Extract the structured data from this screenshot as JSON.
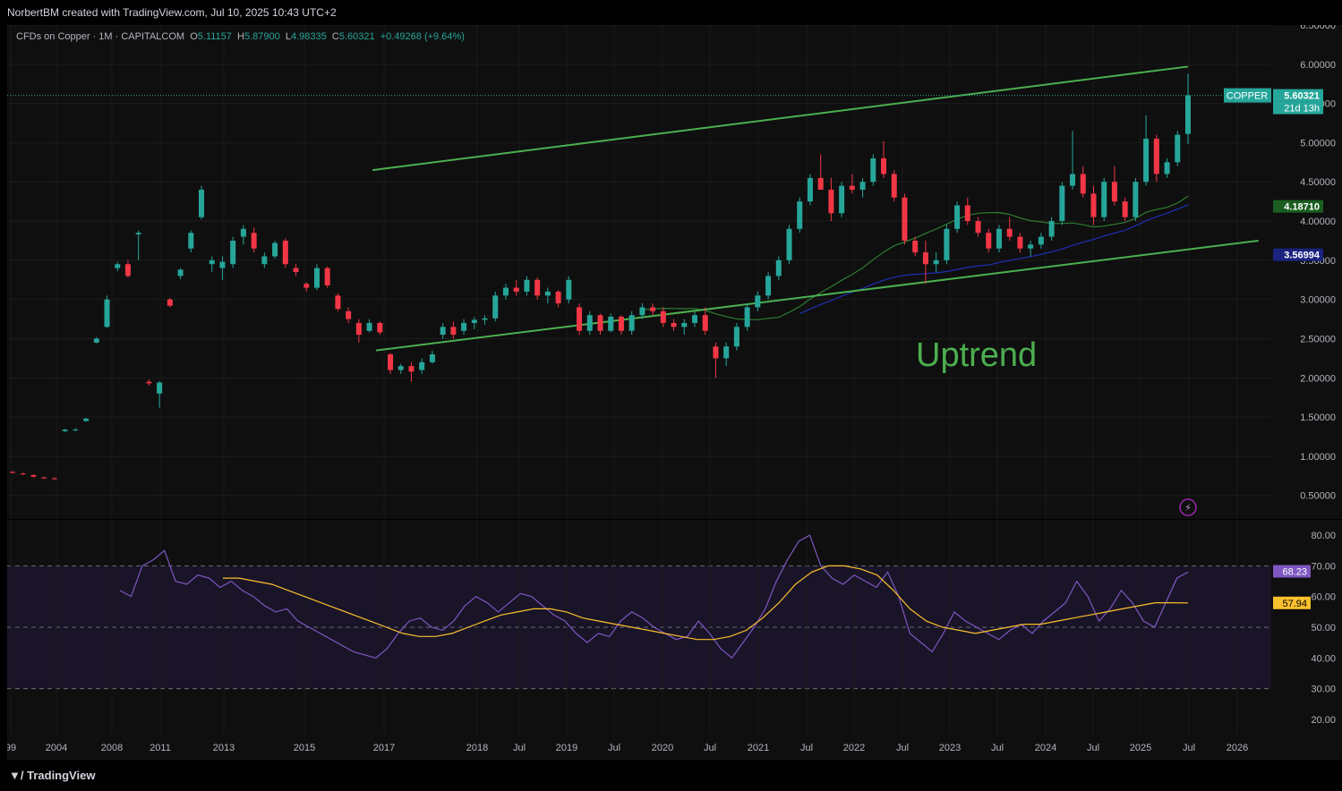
{
  "header": {
    "attribution": "NorbertBM created with TradingView.com, Jul 10, 2025 10:43 UTC+2"
  },
  "legend": {
    "symbol": "CFDs on Copper · 1M · CAPITALCOM",
    "o_label": "O",
    "o": "5.11157",
    "h_label": "H",
    "h": "5.87900",
    "l_label": "L",
    "l": "4.98335",
    "c_label": "C",
    "c": "5.60321",
    "change": "+0.49268 (+9.64%)"
  },
  "footer": {
    "brand": "TradingView"
  },
  "colors": {
    "up": "#26a69a",
    "down": "#f23645",
    "channel": "#4caf50",
    "ma_green": "#2e7d32",
    "ma_blue": "#1e2fb5",
    "rsi": "#7e57c2",
    "rsi_ma": "#fbc02d"
  },
  "chart_data": [
    {
      "type": "candlestick",
      "name": "CFDs on Copper",
      "interval": "1M",
      "ylim": [
        0.2,
        6.5
      ],
      "y_ticks": [
        0.5,
        1.0,
        1.5,
        2.0,
        2.5,
        3.0,
        3.5,
        4.0,
        4.5,
        5.0,
        5.5,
        6.0,
        6.5
      ],
      "x_ticks": [
        {
          "label": "99",
          "t": 1999.0
        },
        {
          "label": "2004",
          "t": 2004.0
        },
        {
          "label": "2008",
          "t": 2008.0
        },
        {
          "label": "2011",
          "t": 2011.0
        },
        {
          "label": "2013",
          "t": 2013.0
        },
        {
          "label": "2015",
          "t": 2015.0
        },
        {
          "label": "2017",
          "t": 2017.0
        },
        {
          "label": "2018",
          "t": 2018.0
        },
        {
          "label": "Jul",
          "t": 2018.5
        },
        {
          "label": "2019",
          "t": 2019.0
        },
        {
          "label": "Jul",
          "t": 2019.5
        },
        {
          "label": "2020",
          "t": 2020.0
        },
        {
          "label": "Jul",
          "t": 2020.5
        },
        {
          "label": "2021",
          "t": 2021.0
        },
        {
          "label": "Jul",
          "t": 2021.5
        },
        {
          "label": "2022",
          "t": 2022.0
        },
        {
          "label": "Jul",
          "t": 2022.5
        },
        {
          "label": "2023",
          "t": 2023.0
        },
        {
          "label": "Jul",
          "t": 2023.5
        },
        {
          "label": "2024",
          "t": 2024.0
        },
        {
          "label": "Jul",
          "t": 2024.5
        },
        {
          "label": "2025",
          "t": 2025.0
        },
        {
          "label": "Jul",
          "t": 2025.5
        },
        {
          "label": "2026",
          "t": 2026.0
        }
      ],
      "last_price": {
        "label": "COPPER",
        "value": "5.60321",
        "countdown": "21d 13h"
      },
      "ma_green_last": "4.18710",
      "ma_blue_last": "3.56994",
      "annotation": "Uptrend",
      "candles": [
        [
          1999.7,
          0.8,
          0.81,
          0.78,
          0.79
        ],
        [
          2000.3,
          0.78,
          0.79,
          0.76,
          0.77
        ],
        [
          2001.0,
          0.76,
          0.77,
          0.73,
          0.74
        ],
        [
          2001.7,
          0.73,
          0.74,
          0.71,
          0.72
        ],
        [
          2002.5,
          0.72,
          0.73,
          0.7,
          0.71
        ],
        [
          2003.3,
          1.32,
          1.35,
          1.31,
          1.34
        ],
        [
          2004.0,
          1.33,
          1.36,
          1.32,
          1.34
        ],
        [
          2004.6,
          1.45,
          1.49,
          1.44,
          1.48
        ],
        [
          2005.2,
          2.45,
          2.52,
          2.44,
          2.5
        ],
        [
          2005.7,
          2.65,
          3.05,
          2.64,
          3.0
        ],
        [
          2006.2,
          3.4,
          3.48,
          3.36,
          3.45
        ],
        [
          2006.6,
          3.45,
          3.5,
          3.28,
          3.3
        ],
        [
          2007.2,
          3.83,
          3.88,
          3.5,
          3.85
        ],
        [
          2007.6,
          1.95,
          1.98,
          1.9,
          1.93
        ],
        [
          2008.0,
          1.8,
          1.96,
          1.62,
          1.94
        ],
        [
          2008.4,
          3.0,
          3.02,
          2.9,
          2.92
        ],
        [
          2008.8,
          3.3,
          3.4,
          3.26,
          3.38
        ],
        [
          2009.3,
          3.65,
          3.88,
          3.6,
          3.85
        ],
        [
          2009.7,
          4.05,
          4.45,
          4.02,
          4.4
        ],
        [
          2010.2,
          3.45,
          3.55,
          3.35,
          3.5
        ],
        [
          2010.6,
          3.4,
          3.55,
          3.25,
          3.48
        ],
        [
          2011.0,
          3.45,
          3.8,
          3.4,
          3.75
        ],
        [
          2011.4,
          3.8,
          3.95,
          3.7,
          3.9
        ],
        [
          2011.7,
          3.85,
          3.92,
          3.6,
          3.65
        ],
        [
          2012.1,
          3.45,
          3.6,
          3.4,
          3.55
        ],
        [
          2012.4,
          3.55,
          3.75,
          3.52,
          3.72
        ],
        [
          2012.8,
          3.75,
          3.78,
          3.4,
          3.45
        ],
        [
          2013.1,
          3.4,
          3.45,
          3.3,
          3.35
        ],
        [
          2013.4,
          3.2,
          3.22,
          3.1,
          3.15
        ],
        [
          2013.8,
          3.15,
          3.45,
          3.12,
          3.4
        ],
        [
          2014.1,
          3.4,
          3.42,
          3.15,
          3.18
        ],
        [
          2014.5,
          3.05,
          3.08,
          2.85,
          2.88
        ],
        [
          2014.8,
          2.85,
          2.9,
          2.7,
          2.75
        ],
        [
          2015.1,
          2.7,
          2.75,
          2.45,
          2.55
        ],
        [
          2015.4,
          2.6,
          2.75,
          2.58,
          2.7
        ],
        [
          2015.7,
          2.7,
          2.72,
          2.55,
          2.58
        ],
        [
          2016.0,
          2.3,
          2.32,
          2.05,
          2.1
        ],
        [
          2016.3,
          2.1,
          2.18,
          2.05,
          2.15
        ],
        [
          2016.6,
          2.15,
          2.2,
          1.95,
          2.08
        ],
        [
          2016.9,
          2.1,
          2.25,
          2.05,
          2.2
        ],
        [
          2017.1,
          2.2,
          2.35,
          2.18,
          2.3
        ],
        [
          2017.4,
          2.55,
          2.7,
          2.5,
          2.65
        ],
        [
          2017.7,
          2.65,
          2.72,
          2.5,
          2.55
        ],
        [
          2018.0,
          2.6,
          2.75,
          2.55,
          2.7
        ],
        [
          2018.3,
          2.7,
          2.78,
          2.62,
          2.74
        ],
        [
          2018.6,
          2.74,
          2.8,
          2.68,
          2.76
        ],
        [
          2018.9,
          2.76,
          3.1,
          2.72,
          3.05
        ],
        [
          2019.2,
          3.05,
          3.2,
          3.0,
          3.15
        ],
        [
          2019.4,
          3.15,
          3.25,
          3.05,
          3.1
        ],
        [
          2019.6,
          3.1,
          3.3,
          3.05,
          3.25
        ],
        [
          2019.8,
          3.25,
          3.28,
          3.0,
          3.05
        ],
        [
          2020.1,
          3.05,
          3.15,
          2.95,
          3.1
        ],
        [
          2020.3,
          3.1,
          3.12,
          2.9,
          2.95
        ],
        [
          2020.5,
          3.0,
          3.3,
          2.95,
          3.25
        ],
        [
          2020.7,
          2.9,
          2.95,
          2.55,
          2.6
        ],
        [
          2020.9,
          2.6,
          2.85,
          2.55,
          2.8
        ],
        [
          2021.1,
          2.8,
          2.82,
          2.55,
          2.6
        ],
        [
          2021.3,
          2.6,
          2.82,
          2.58,
          2.78
        ],
        [
          2021.5,
          2.78,
          2.8,
          2.55,
          2.6
        ],
        [
          2021.7,
          2.6,
          2.85,
          2.55,
          2.8
        ],
        [
          2021.9,
          2.8,
          2.95,
          2.75,
          2.9
        ],
        [
          2022.1,
          2.9,
          2.95,
          2.8,
          2.85
        ],
        [
          2022.3,
          2.85,
          2.9,
          2.65,
          2.7
        ],
        [
          2022.5,
          2.7,
          2.75,
          2.6,
          2.65
        ],
        [
          2022.7,
          2.65,
          2.75,
          2.55,
          2.7
        ],
        [
          2022.9,
          2.7,
          2.85,
          2.65,
          2.8
        ],
        [
          2023.1,
          2.8,
          2.9,
          2.55,
          2.6
        ],
        [
          2023.3,
          2.4,
          2.45,
          2.0,
          2.25
        ],
        [
          2023.5,
          2.25,
          2.45,
          2.15,
          2.4
        ],
        [
          2023.7,
          2.4,
          2.7,
          2.35,
          2.65
        ],
        [
          2023.9,
          2.65,
          2.95,
          2.6,
          2.9
        ],
        [
          2024.1,
          2.9,
          3.1,
          2.85,
          3.05
        ],
        [
          2024.3,
          3.05,
          3.35,
          3.0,
          3.3
        ],
        [
          2024.5,
          3.3,
          3.55,
          3.25,
          3.5
        ],
        [
          2024.7,
          3.5,
          3.95,
          3.45,
          3.9
        ],
        [
          2024.9,
          3.9,
          4.3,
          3.85,
          4.25
        ],
        [
          2025.1,
          4.25,
          4.6,
          4.2,
          4.55
        ],
        [
          2025.3,
          4.55,
          4.85,
          4.45,
          4.4
        ],
        [
          2025.5,
          4.4,
          4.55,
          4.0,
          4.1
        ],
        [
          2025.7,
          4.1,
          4.5,
          4.05,
          4.45
        ],
        [
          2025.9,
          4.45,
          4.6,
          4.35,
          4.4
        ],
        [
          2026.1,
          4.4,
          4.55,
          4.3,
          4.5
        ],
        [
          2026.3,
          4.5,
          4.85,
          4.45,
          4.8
        ],
        [
          2026.5,
          4.8,
          5.02,
          4.55,
          4.6
        ],
        [
          2026.7,
          4.6,
          4.65,
          4.25,
          4.3
        ],
        [
          2026.9,
          4.3,
          4.35,
          3.7,
          3.75
        ],
        [
          2027.1,
          3.75,
          3.8,
          3.55,
          3.6
        ],
        [
          2027.3,
          3.6,
          3.75,
          3.2,
          3.45
        ],
        [
          2027.5,
          3.45,
          3.6,
          3.35,
          3.5
        ],
        [
          2027.7,
          3.5,
          3.95,
          3.45,
          3.9
        ],
        [
          2027.9,
          3.9,
          4.25,
          3.85,
          4.2
        ],
        [
          2028.1,
          4.2,
          4.3,
          3.95,
          4.0
        ],
        [
          2028.3,
          4.0,
          4.05,
          3.8,
          3.85
        ],
        [
          2028.5,
          3.85,
          3.9,
          3.6,
          3.65
        ],
        [
          2028.7,
          3.65,
          3.95,
          3.6,
          3.9
        ],
        [
          2028.9,
          3.9,
          4.05,
          3.75,
          3.8
        ],
        [
          2029.1,
          3.8,
          3.85,
          3.6,
          3.65
        ],
        [
          2029.3,
          3.65,
          3.75,
          3.55,
          3.7
        ],
        [
          2029.5,
          3.7,
          3.85,
          3.65,
          3.8
        ],
        [
          2029.7,
          3.8,
          4.05,
          3.75,
          4.0
        ],
        [
          2029.9,
          4.0,
          4.5,
          3.95,
          4.45
        ],
        [
          2030.1,
          4.45,
          5.15,
          4.4,
          4.6
        ],
        [
          2030.3,
          4.6,
          4.7,
          4.3,
          4.35
        ],
        [
          2030.5,
          4.35,
          4.45,
          3.95,
          4.05
        ],
        [
          2030.7,
          4.05,
          4.55,
          4.0,
          4.5
        ],
        [
          2030.9,
          4.5,
          4.7,
          4.2,
          4.25
        ],
        [
          2031.1,
          4.25,
          4.3,
          4.0,
          4.05
        ],
        [
          2031.3,
          4.05,
          4.55,
          4.0,
          4.5
        ],
        [
          2031.5,
          4.5,
          5.35,
          4.45,
          5.05
        ],
        [
          2031.7,
          5.05,
          5.1,
          4.5,
          4.6
        ],
        [
          2031.9,
          4.6,
          4.8,
          4.55,
          4.75
        ],
        [
          2032.1,
          4.75,
          5.15,
          4.7,
          5.1
        ],
        [
          2032.3,
          5.11157,
          5.879,
          4.98335,
          5.60321
        ]
      ],
      "x_display_range": [
        1999.0,
        2026.8
      ]
    },
    {
      "type": "line",
      "name": "RSI",
      "ylim": [
        20,
        80
      ],
      "y_ticks": [
        20,
        30,
        40,
        50,
        60,
        70,
        80
      ],
      "levels": [
        30,
        50,
        70
      ],
      "last_rsi": "68.23",
      "last_rsi_ma": "57.94",
      "series": [
        {
          "values": [
            62,
            60,
            70,
            72,
            75,
            65,
            64,
            67,
            66,
            63,
            65,
            62,
            60,
            57,
            55,
            56,
            52,
            50,
            48,
            46,
            44,
            42,
            41,
            40,
            43,
            48,
            52,
            53,
            50,
            49,
            52,
            57,
            60,
            58,
            55,
            58,
            61,
            60,
            57,
            54,
            52,
            48,
            45,
            48,
            47,
            52,
            55,
            53,
            50,
            48,
            46,
            47,
            52,
            48,
            43,
            40,
            45,
            50,
            56,
            65,
            72,
            78,
            80,
            70,
            66,
            64,
            67,
            65,
            63,
            68,
            60,
            48,
            45,
            42,
            48,
            55,
            52,
            50,
            48,
            46,
            49,
            51,
            48,
            52,
            55,
            58,
            65,
            60,
            52,
            56,
            62,
            58,
            52,
            50,
            58,
            66,
            68
          ]
        },
        {
          "values": [
            66,
            66,
            65,
            64,
            62,
            60,
            58,
            56,
            54,
            52,
            50,
            48,
            47,
            47,
            48,
            50,
            52,
            54,
            55,
            56,
            56,
            55,
            53,
            52,
            51,
            50,
            49,
            48,
            47,
            46,
            46,
            47,
            49,
            53,
            58,
            64,
            68,
            70,
            70,
            69,
            67,
            62,
            56,
            52,
            50,
            49,
            48,
            49,
            50,
            51,
            51,
            52,
            53,
            54,
            55,
            56,
            57,
            58,
            58,
            57.94
          ]
        }
      ]
    }
  ]
}
